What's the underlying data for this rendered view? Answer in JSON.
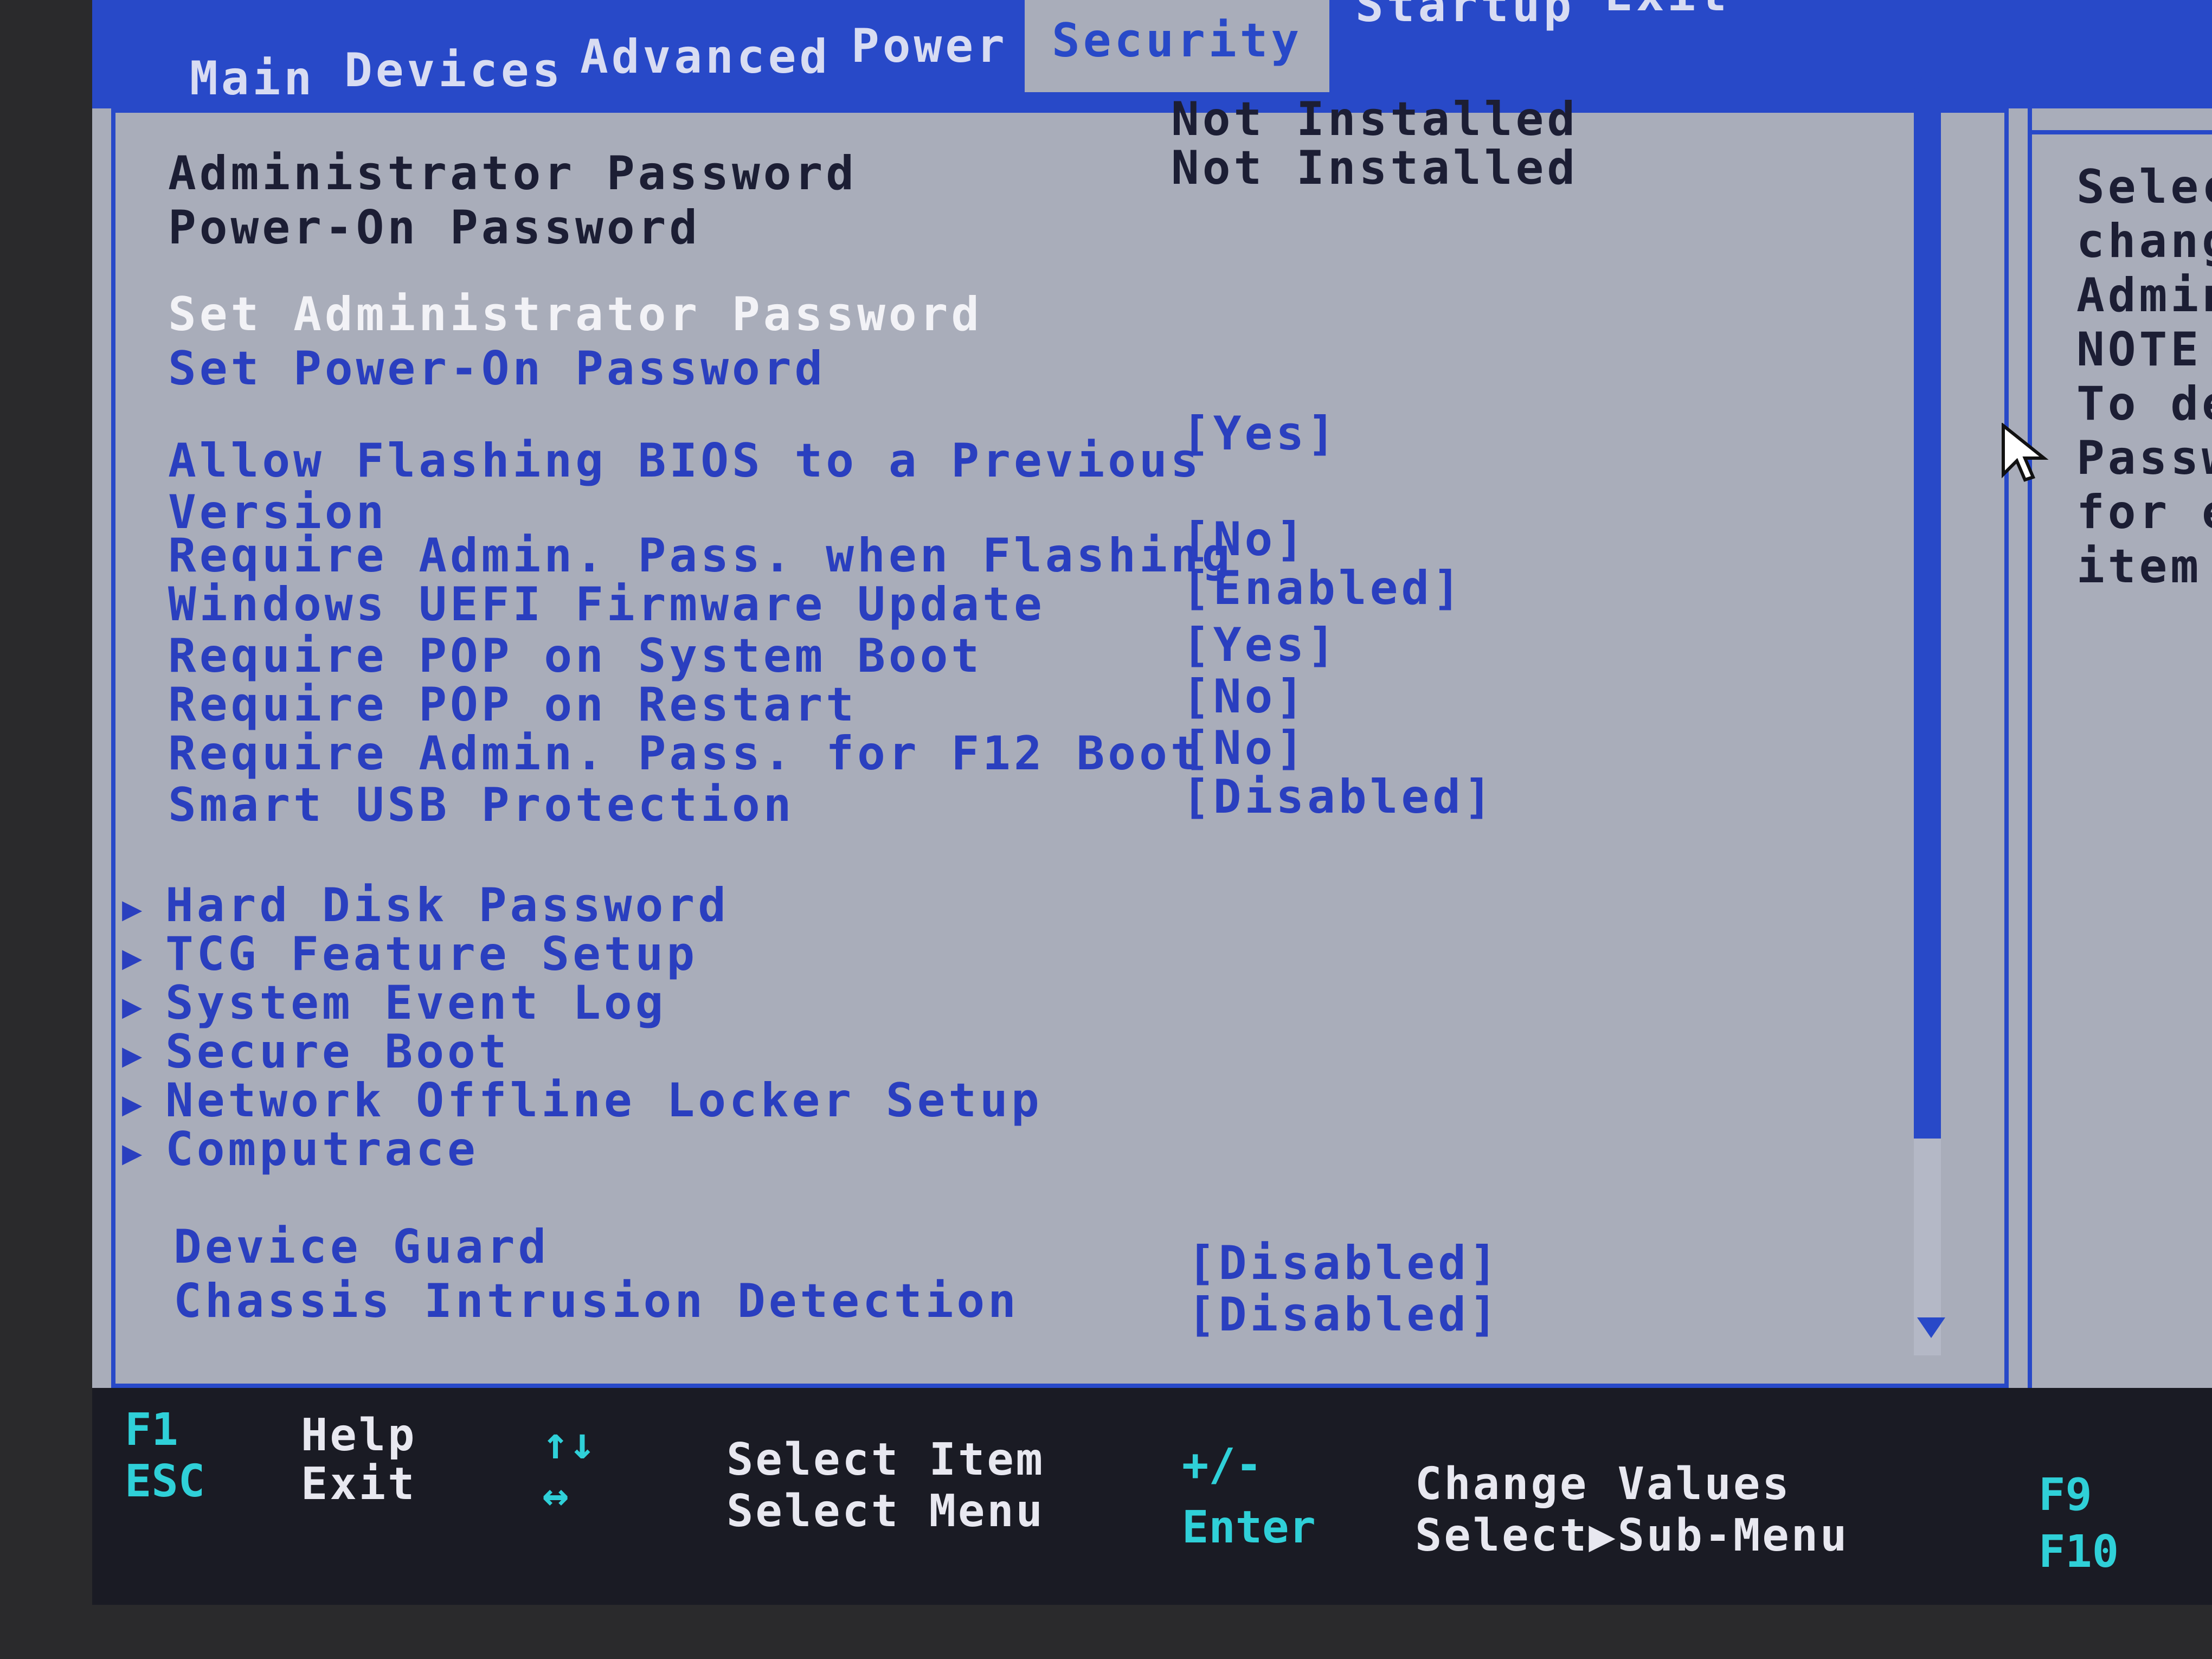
{
  "tabs": [
    {
      "label": "Main"
    },
    {
      "label": "Devices"
    },
    {
      "label": "Advanced"
    },
    {
      "label": "Power"
    },
    {
      "label": "Security"
    },
    {
      "label": "Startup"
    },
    {
      "label": "Exit"
    }
  ],
  "status": {
    "admin_password_label": "Administrator Password",
    "poweron_password_label": "Power-On Password",
    "admin_password_value": "Not Installed",
    "poweron_password_value": "Not Installed"
  },
  "actions": {
    "set_admin": "Set Administrator Password",
    "set_poweron": "Set Power-On Password"
  },
  "settings": [
    {
      "label": "Allow Flashing BIOS to a Previous",
      "label2": "Version",
      "value": "[Yes]"
    },
    {
      "label": "Require Admin. Pass. when Flashing",
      "value": "[No]"
    },
    {
      "label": "Windows UEFI Firmware Update",
      "value": "[Enabled]"
    },
    {
      "label": "Require POP on System Boot",
      "value": "[Yes]"
    },
    {
      "label": "Require POP on Restart",
      "value": "[No]"
    },
    {
      "label": "Require Admin. Pass. for F12 Boot",
      "value": "[No]"
    },
    {
      "label": "Smart USB Protection",
      "value": "[Disabled]"
    }
  ],
  "submenus": [
    {
      "label": "Hard Disk Password"
    },
    {
      "label": "TCG Feature Setup"
    },
    {
      "label": "System Event Log"
    },
    {
      "label": "Secure Boot"
    },
    {
      "label": "Network Offline Locker Setup"
    },
    {
      "label": "Computrace"
    }
  ],
  "bottom_settings": [
    {
      "label": "Device Guard",
      "value": "[Disabled]"
    },
    {
      "label": "Chassis Intrusion Detection",
      "value": "[Disabled]"
    }
  ],
  "help": {
    "lines": [
      "Select",
      "change,",
      "Adminis",
      "NOTE:",
      "To dele",
      "Passwor",
      "for eac",
      "item."
    ]
  },
  "footer": {
    "f1_key": "F1",
    "f1_desc": "Help",
    "esc_key": "ESC",
    "esc_desc": "Exit",
    "updown_key": "↑↓",
    "updown_desc": "Select Item",
    "leftright_key": "↔",
    "leftright_desc": "Select Menu",
    "plusminus_key": "+/-",
    "plusminus_desc": "Change Values",
    "enter_key": "Enter",
    "enter_desc": "Select▶Sub-Menu",
    "f9_key": "F9",
    "f10_key": "F10"
  },
  "colors": {
    "accent_blue": "#2849c8",
    "background": "#a9adba",
    "highlight_text": "#f2f2f6",
    "footer_key": "#2fd0d8"
  }
}
